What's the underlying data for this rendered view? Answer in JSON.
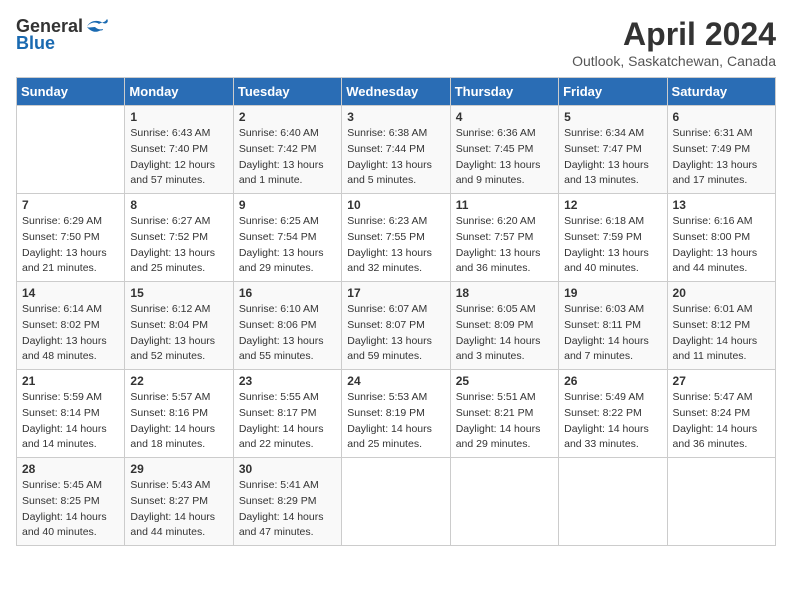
{
  "header": {
    "logo_general": "General",
    "logo_blue": "Blue",
    "month_title": "April 2024",
    "location": "Outlook, Saskatchewan, Canada"
  },
  "days_of_week": [
    "Sunday",
    "Monday",
    "Tuesday",
    "Wednesday",
    "Thursday",
    "Friday",
    "Saturday"
  ],
  "weeks": [
    [
      {
        "date": "",
        "sunrise": "",
        "sunset": "",
        "daylight": ""
      },
      {
        "date": "1",
        "sunrise": "Sunrise: 6:43 AM",
        "sunset": "Sunset: 7:40 PM",
        "daylight": "Daylight: 12 hours and 57 minutes."
      },
      {
        "date": "2",
        "sunrise": "Sunrise: 6:40 AM",
        "sunset": "Sunset: 7:42 PM",
        "daylight": "Daylight: 13 hours and 1 minute."
      },
      {
        "date": "3",
        "sunrise": "Sunrise: 6:38 AM",
        "sunset": "Sunset: 7:44 PM",
        "daylight": "Daylight: 13 hours and 5 minutes."
      },
      {
        "date": "4",
        "sunrise": "Sunrise: 6:36 AM",
        "sunset": "Sunset: 7:45 PM",
        "daylight": "Daylight: 13 hours and 9 minutes."
      },
      {
        "date": "5",
        "sunrise": "Sunrise: 6:34 AM",
        "sunset": "Sunset: 7:47 PM",
        "daylight": "Daylight: 13 hours and 13 minutes."
      },
      {
        "date": "6",
        "sunrise": "Sunrise: 6:31 AM",
        "sunset": "Sunset: 7:49 PM",
        "daylight": "Daylight: 13 hours and 17 minutes."
      }
    ],
    [
      {
        "date": "7",
        "sunrise": "Sunrise: 6:29 AM",
        "sunset": "Sunset: 7:50 PM",
        "daylight": "Daylight: 13 hours and 21 minutes."
      },
      {
        "date": "8",
        "sunrise": "Sunrise: 6:27 AM",
        "sunset": "Sunset: 7:52 PM",
        "daylight": "Daylight: 13 hours and 25 minutes."
      },
      {
        "date": "9",
        "sunrise": "Sunrise: 6:25 AM",
        "sunset": "Sunset: 7:54 PM",
        "daylight": "Daylight: 13 hours and 29 minutes."
      },
      {
        "date": "10",
        "sunrise": "Sunrise: 6:23 AM",
        "sunset": "Sunset: 7:55 PM",
        "daylight": "Daylight: 13 hours and 32 minutes."
      },
      {
        "date": "11",
        "sunrise": "Sunrise: 6:20 AM",
        "sunset": "Sunset: 7:57 PM",
        "daylight": "Daylight: 13 hours and 36 minutes."
      },
      {
        "date": "12",
        "sunrise": "Sunrise: 6:18 AM",
        "sunset": "Sunset: 7:59 PM",
        "daylight": "Daylight: 13 hours and 40 minutes."
      },
      {
        "date": "13",
        "sunrise": "Sunrise: 6:16 AM",
        "sunset": "Sunset: 8:00 PM",
        "daylight": "Daylight: 13 hours and 44 minutes."
      }
    ],
    [
      {
        "date": "14",
        "sunrise": "Sunrise: 6:14 AM",
        "sunset": "Sunset: 8:02 PM",
        "daylight": "Daylight: 13 hours and 48 minutes."
      },
      {
        "date": "15",
        "sunrise": "Sunrise: 6:12 AM",
        "sunset": "Sunset: 8:04 PM",
        "daylight": "Daylight: 13 hours and 52 minutes."
      },
      {
        "date": "16",
        "sunrise": "Sunrise: 6:10 AM",
        "sunset": "Sunset: 8:06 PM",
        "daylight": "Daylight: 13 hours and 55 minutes."
      },
      {
        "date": "17",
        "sunrise": "Sunrise: 6:07 AM",
        "sunset": "Sunset: 8:07 PM",
        "daylight": "Daylight: 13 hours and 59 minutes."
      },
      {
        "date": "18",
        "sunrise": "Sunrise: 6:05 AM",
        "sunset": "Sunset: 8:09 PM",
        "daylight": "Daylight: 14 hours and 3 minutes."
      },
      {
        "date": "19",
        "sunrise": "Sunrise: 6:03 AM",
        "sunset": "Sunset: 8:11 PM",
        "daylight": "Daylight: 14 hours and 7 minutes."
      },
      {
        "date": "20",
        "sunrise": "Sunrise: 6:01 AM",
        "sunset": "Sunset: 8:12 PM",
        "daylight": "Daylight: 14 hours and 11 minutes."
      }
    ],
    [
      {
        "date": "21",
        "sunrise": "Sunrise: 5:59 AM",
        "sunset": "Sunset: 8:14 PM",
        "daylight": "Daylight: 14 hours and 14 minutes."
      },
      {
        "date": "22",
        "sunrise": "Sunrise: 5:57 AM",
        "sunset": "Sunset: 8:16 PM",
        "daylight": "Daylight: 14 hours and 18 minutes."
      },
      {
        "date": "23",
        "sunrise": "Sunrise: 5:55 AM",
        "sunset": "Sunset: 8:17 PM",
        "daylight": "Daylight: 14 hours and 22 minutes."
      },
      {
        "date": "24",
        "sunrise": "Sunrise: 5:53 AM",
        "sunset": "Sunset: 8:19 PM",
        "daylight": "Daylight: 14 hours and 25 minutes."
      },
      {
        "date": "25",
        "sunrise": "Sunrise: 5:51 AM",
        "sunset": "Sunset: 8:21 PM",
        "daylight": "Daylight: 14 hours and 29 minutes."
      },
      {
        "date": "26",
        "sunrise": "Sunrise: 5:49 AM",
        "sunset": "Sunset: 8:22 PM",
        "daylight": "Daylight: 14 hours and 33 minutes."
      },
      {
        "date": "27",
        "sunrise": "Sunrise: 5:47 AM",
        "sunset": "Sunset: 8:24 PM",
        "daylight": "Daylight: 14 hours and 36 minutes."
      }
    ],
    [
      {
        "date": "28",
        "sunrise": "Sunrise: 5:45 AM",
        "sunset": "Sunset: 8:25 PM",
        "daylight": "Daylight: 14 hours and 40 minutes."
      },
      {
        "date": "29",
        "sunrise": "Sunrise: 5:43 AM",
        "sunset": "Sunset: 8:27 PM",
        "daylight": "Daylight: 14 hours and 44 minutes."
      },
      {
        "date": "30",
        "sunrise": "Sunrise: 5:41 AM",
        "sunset": "Sunset: 8:29 PM",
        "daylight": "Daylight: 14 hours and 47 minutes."
      },
      {
        "date": "",
        "sunrise": "",
        "sunset": "",
        "daylight": ""
      },
      {
        "date": "",
        "sunrise": "",
        "sunset": "",
        "daylight": ""
      },
      {
        "date": "",
        "sunrise": "",
        "sunset": "",
        "daylight": ""
      },
      {
        "date": "",
        "sunrise": "",
        "sunset": "",
        "daylight": ""
      }
    ]
  ]
}
